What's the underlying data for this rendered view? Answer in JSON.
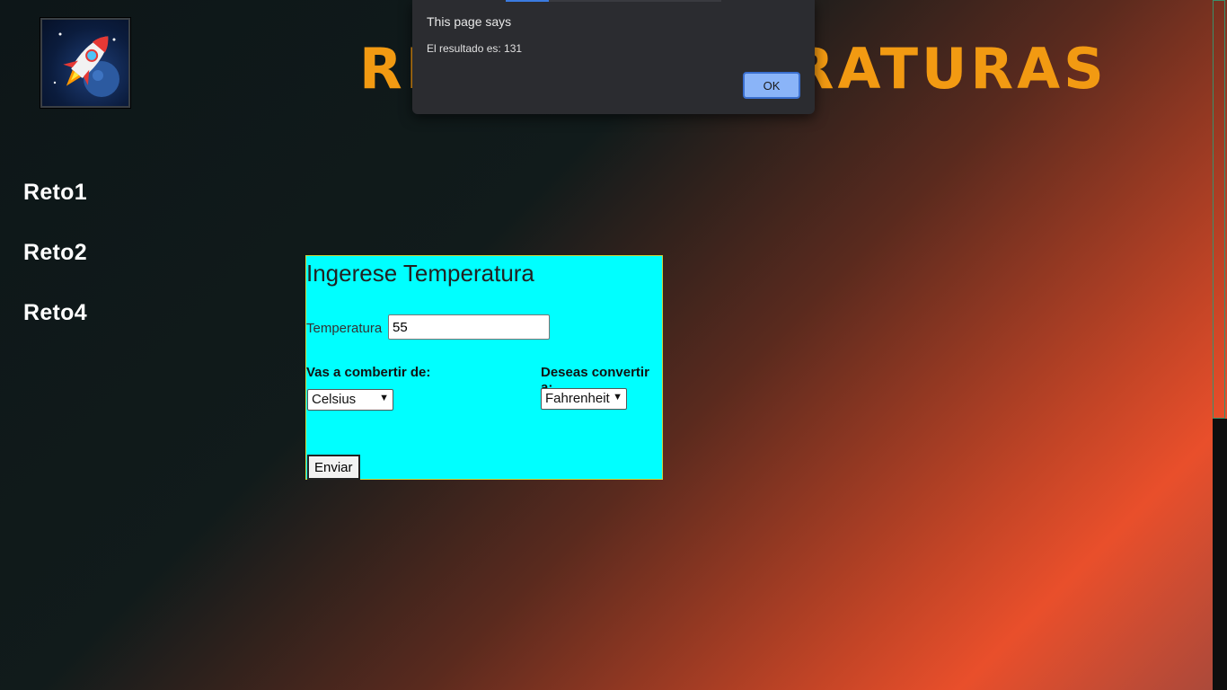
{
  "header": {
    "title": "RETO TEMPERATURAS",
    "logo_icon": "rocket-icon"
  },
  "nav": {
    "items": [
      {
        "label": "Reto1"
      },
      {
        "label": "Reto2"
      },
      {
        "label": "Reto4"
      }
    ]
  },
  "form": {
    "heading": "Ingerese Temperatura",
    "temp_label": "Temperatura",
    "temp_value": "55",
    "from_label": "Vas a combertir de:",
    "from_selected": "Celsius",
    "to_label": "Deseas convertir a:",
    "to_selected": "Fahrenheit",
    "submit_label": "Enviar",
    "background_color": "#00ffff"
  },
  "dialog": {
    "title": "This page says",
    "message": "El resultado es: 131",
    "ok_label": "OK"
  }
}
